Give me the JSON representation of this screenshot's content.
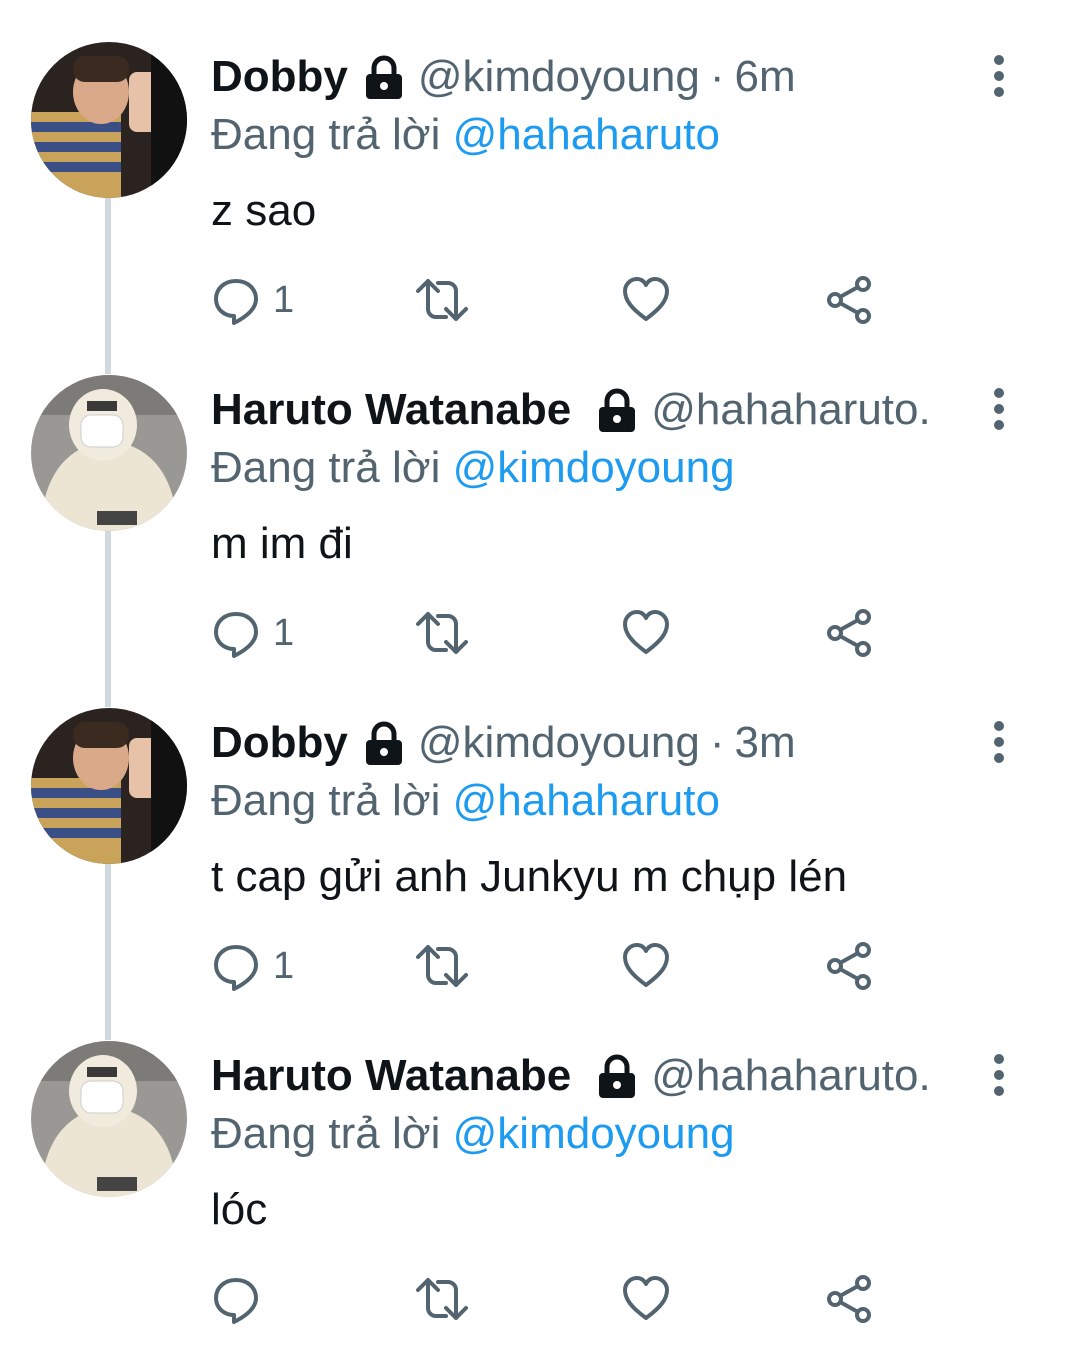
{
  "tweets": [
    {
      "display_name": "Dobby",
      "handle": "@kimdoyoung",
      "time_sep": "·",
      "time": "6m",
      "reply_prefix": "Đang trả lời",
      "reply_to": "@hahaharuto",
      "text": "z sao",
      "reply_count": "1",
      "avatar": "avatar-dobby"
    },
    {
      "display_name": "Haruto Watanabe",
      "handle": "@hahaharuto.",
      "time_sep": "",
      "time": "",
      "reply_prefix": "Đang trả lời",
      "reply_to": "@kimdoyoung",
      "text": "m im đi",
      "reply_count": "1",
      "avatar": "avatar-haruto"
    },
    {
      "display_name": "Dobby",
      "handle": "@kimdoyoung",
      "time_sep": "·",
      "time": "3m",
      "reply_prefix": "Đang trả lời",
      "reply_to": "@hahaharuto",
      "text": "t cap gửi anh Junkyu m chụp lén",
      "reply_count": "1",
      "avatar": "avatar-dobby"
    },
    {
      "display_name": "Haruto Watanabe",
      "handle": "@hahaharuto.",
      "time_sep": "",
      "time": "",
      "reply_prefix": "Đang trả lời",
      "reply_to": "@kimdoyoung",
      "text": "lóc",
      "reply_count": "",
      "avatar": "avatar-haruto"
    }
  ],
  "colors": {
    "text_primary": "#0f1419",
    "text_secondary": "#536471",
    "accent": "#1d9bf0",
    "thread_line": "#cfd9de"
  },
  "icons": [
    "lock-icon",
    "more-icon",
    "reply-icon",
    "retweet-icon",
    "like-icon",
    "share-icon"
  ]
}
